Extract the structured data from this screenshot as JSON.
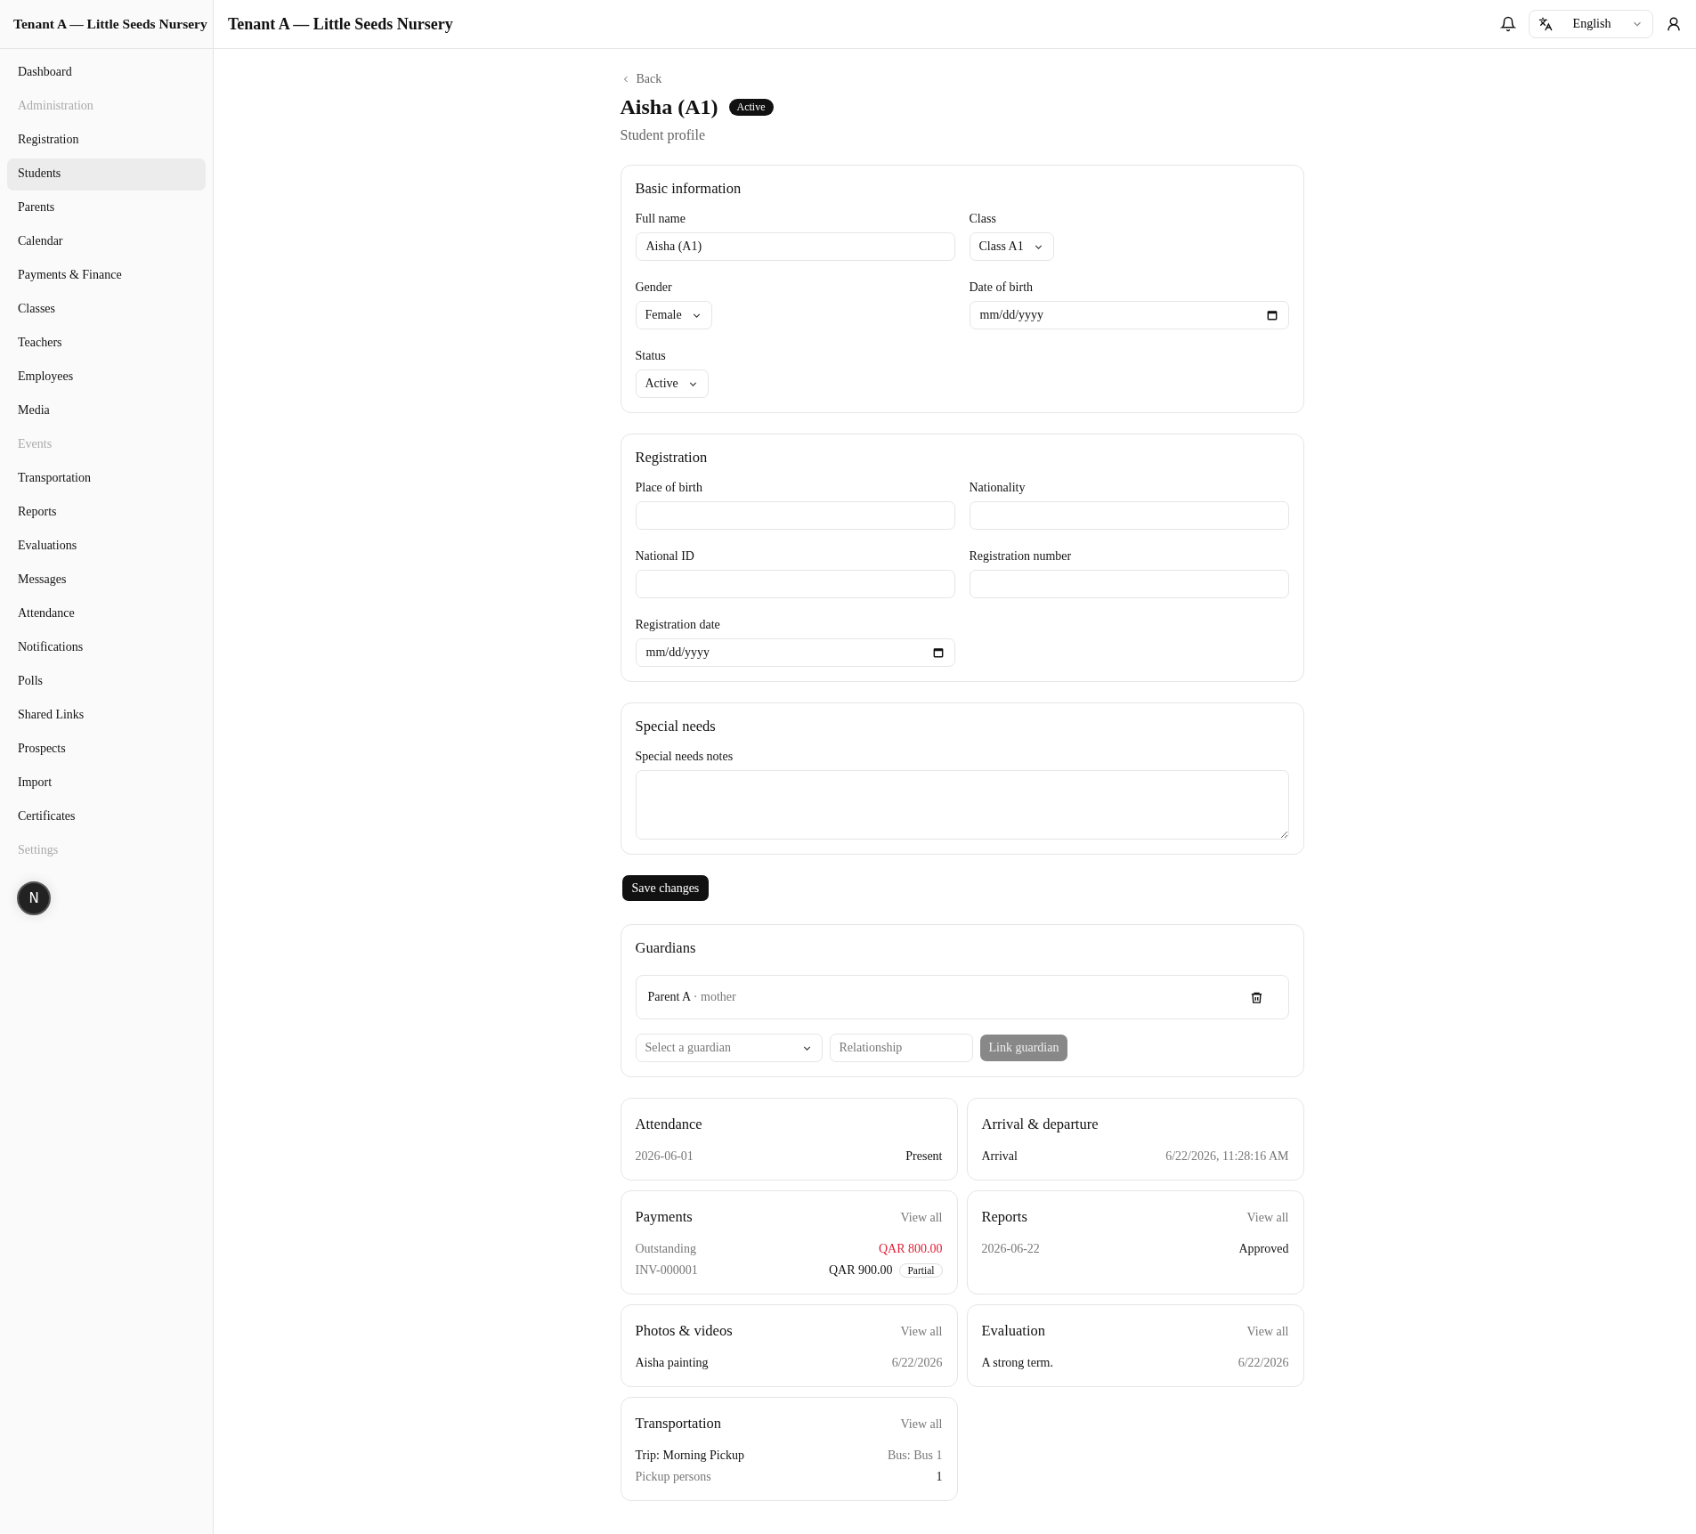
{
  "sidebar": {
    "brand": "Tenant A — Little Seeds Nursery",
    "items": [
      {
        "label": "Dashboard",
        "selected": false,
        "disabled": false
      },
      {
        "label": "Administration",
        "selected": false,
        "disabled": true
      },
      {
        "label": "Registration",
        "selected": false,
        "disabled": false
      },
      {
        "label": "Students",
        "selected": true,
        "disabled": false
      },
      {
        "label": "Parents",
        "selected": false,
        "disabled": false
      },
      {
        "label": "Calendar",
        "selected": false,
        "disabled": false
      },
      {
        "label": "Payments & Finance",
        "selected": false,
        "disabled": false
      },
      {
        "label": "Classes",
        "selected": false,
        "disabled": false
      },
      {
        "label": "Teachers",
        "selected": false,
        "disabled": false
      },
      {
        "label": "Employees",
        "selected": false,
        "disabled": false
      },
      {
        "label": "Media",
        "selected": false,
        "disabled": false
      },
      {
        "label": "Events",
        "selected": false,
        "disabled": true
      },
      {
        "label": "Transportation",
        "selected": false,
        "disabled": false
      },
      {
        "label": "Reports",
        "selected": false,
        "disabled": false
      },
      {
        "label": "Evaluations",
        "selected": false,
        "disabled": false
      },
      {
        "label": "Messages",
        "selected": false,
        "disabled": false
      },
      {
        "label": "Attendance",
        "selected": false,
        "disabled": false
      },
      {
        "label": "Notifications",
        "selected": false,
        "disabled": false
      },
      {
        "label": "Polls",
        "selected": false,
        "disabled": false
      },
      {
        "label": "Shared Links",
        "selected": false,
        "disabled": false
      },
      {
        "label": "Prospects",
        "selected": false,
        "disabled": false
      },
      {
        "label": "Import",
        "selected": false,
        "disabled": false
      },
      {
        "label": "Certificates",
        "selected": false,
        "disabled": false
      },
      {
        "label": "Settings",
        "selected": false,
        "disabled": true
      }
    ]
  },
  "dev_indicator": {
    "label": "N"
  },
  "header": {
    "title": "Tenant A — Little Seeds Nursery",
    "language": "English"
  },
  "back": "Back",
  "profile": {
    "name": "Aisha (A1)",
    "status_badge": "Active",
    "subtitle": "Student profile"
  },
  "sections": [
    {
      "title": "Basic information",
      "fields": [
        {
          "label": "Full name",
          "kind": "text",
          "value": "Aisha (A1)"
        },
        {
          "label": "Class",
          "kind": "select",
          "value": "Class A1"
        },
        {
          "label": "Gender",
          "kind": "select",
          "value": "Female"
        },
        {
          "label": "Date of birth",
          "kind": "date",
          "value": "mm/dd/yyyy"
        },
        {
          "label": "Status",
          "kind": "select",
          "value": "Active"
        }
      ]
    },
    {
      "title": "Registration",
      "fields": [
        {
          "label": "Place of birth",
          "kind": "text"
        },
        {
          "label": "Nationality",
          "kind": "text"
        },
        {
          "label": "National ID",
          "kind": "text"
        },
        {
          "label": "Registration number",
          "kind": "text"
        },
        {
          "label": "Registration date",
          "kind": "date",
          "value": "mm/dd/yyyy"
        }
      ]
    },
    {
      "title": "Special needs",
      "fields": [
        {
          "label": "Special needs notes",
          "kind": "textarea"
        }
      ]
    }
  ],
  "save_button": "Save changes",
  "guardians": {
    "title": "Guardians",
    "items": [
      {
        "name": "Parent A",
        "separator": "·",
        "relationship": "mother"
      }
    ],
    "select_placeholder": "Select a guardian",
    "relationship_placeholder": "Relationship",
    "link_button": {
      "label": "Link guardian",
      "disabled": true
    }
  },
  "summary_cards": [
    {
      "title": "Attendance",
      "rows": [
        {
          "label": "2026-06-01",
          "label_muted": true,
          "value": "Present",
          "value_muted": false,
          "value_alert": false
        }
      ]
    },
    {
      "title": "Arrival & departure",
      "rows": [
        {
          "label": "Arrival",
          "label_muted": false,
          "value": "6/22/2026, 11:28:16 AM",
          "value_muted": true,
          "value_alert": false
        }
      ]
    },
    {
      "title": "Payments",
      "link": "View all",
      "rows": [
        {
          "label": "Outstanding",
          "label_muted": true,
          "value": "QAR 800.00",
          "value_muted": false,
          "value_alert": true
        },
        {
          "label": "INV-000001",
          "label_muted": true,
          "value": "QAR 900.00",
          "value_muted": false,
          "value_alert": false,
          "badge": "Partial"
        }
      ]
    },
    {
      "title": "Reports",
      "link": "View all",
      "rows": [
        {
          "label": "2026-06-22",
          "label_muted": true,
          "value": "Approved",
          "value_muted": false,
          "value_alert": false
        }
      ]
    },
    {
      "title": "Photos & videos",
      "link": "View all",
      "rows": [
        {
          "label": "Aisha painting",
          "label_muted": false,
          "value": "6/22/2026",
          "value_muted": true,
          "value_alert": false
        }
      ]
    },
    {
      "title": "Evaluation",
      "link": "View all",
      "rows": [
        {
          "label": "A strong term.",
          "label_muted": false,
          "value": "6/22/2026",
          "value_muted": true,
          "value_alert": false
        }
      ]
    },
    {
      "title": "Transportation",
      "link": "View all",
      "rows": [
        {
          "label": "Trip: Morning Pickup",
          "label_muted": false,
          "value": "Bus: Bus 1",
          "value_muted": true,
          "value_alert": false
        },
        {
          "label": "Pickup persons",
          "label_muted": true,
          "value": "1",
          "value_muted": false,
          "value_alert": false
        }
      ]
    }
  ]
}
